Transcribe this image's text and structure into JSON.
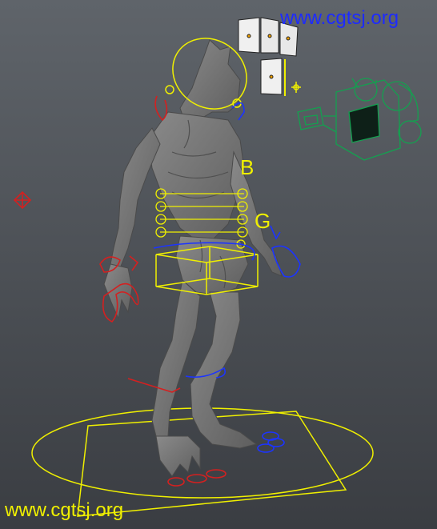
{
  "viewport": {
    "background_top": "#5f646a",
    "background_bottom": "#3a3d42",
    "model_color": "#7a7a7a",
    "rig_colors": {
      "yellow": "#f0f000",
      "red": "#d42020",
      "blue": "#1c34ff",
      "green": "#14a050",
      "camera_dark": "#0e2018"
    }
  },
  "watermark": {
    "top": "www.cgtsj.org",
    "top_color": "#1d2bff",
    "bottom": "www.cgtsj.org",
    "bottom_color": "#f0f000"
  },
  "rig_labels": {
    "b": "B",
    "g": "G"
  },
  "icons": [
    "camera-icon",
    "light-cards-icon",
    "locator-icon"
  ]
}
